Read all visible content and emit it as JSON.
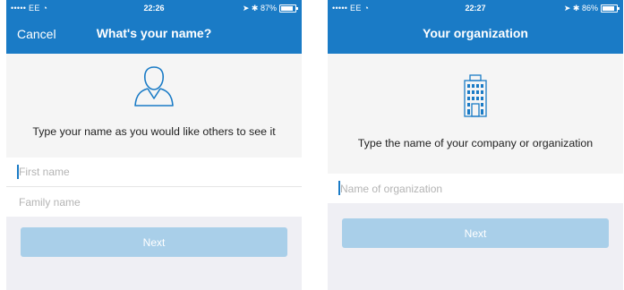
{
  "screens": {
    "name": {
      "status": {
        "carrier": "••••• EE ◔",
        "time": "22:26",
        "battery_text": "➤ ✱ 87%",
        "battery_level": 0.87
      },
      "nav": {
        "cancel_label": "Cancel",
        "title": "What's your name?"
      },
      "icon": "person-outline-icon",
      "instruction": "Type your name as you would like others to see it",
      "fields": {
        "first_name_placeholder": "First name",
        "family_name_placeholder": "Family name"
      },
      "next_label": "Next"
    },
    "organization": {
      "status": {
        "carrier": "••••• EE ◔",
        "time": "22:27",
        "battery_text": "➤ ✱ 86%",
        "battery_level": 0.86
      },
      "nav": {
        "title": "Your organization"
      },
      "icon": "building-icon",
      "instruction": "Type the name of your company or organization",
      "fields": {
        "organization_placeholder": "Name of organization"
      },
      "next_label": "Next"
    }
  },
  "colors": {
    "accent": "#1a7bc6",
    "button_disabled": "#a9cfe9",
    "background": "#efeff4"
  }
}
